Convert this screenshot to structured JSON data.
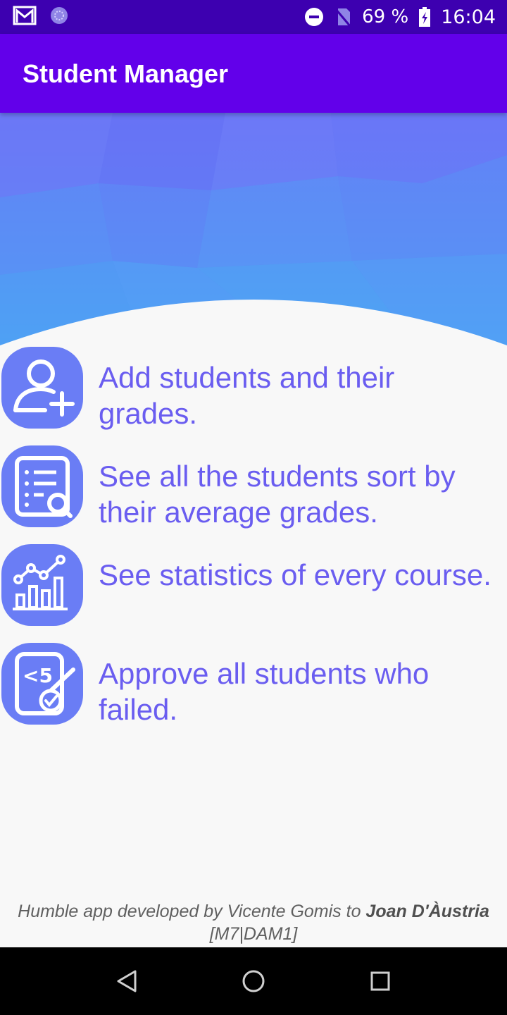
{
  "status_bar": {
    "battery": "69 %",
    "time": "16:04",
    "icons": [
      "gmail-icon",
      "sync-icon",
      "do-not-disturb-icon",
      "no-sim-icon",
      "battery-charging-icon"
    ]
  },
  "app_bar": {
    "title": "Student Manager"
  },
  "features": [
    {
      "icon": "add-user-icon",
      "text": "Add students and their grades."
    },
    {
      "icon": "list-search-icon",
      "text": "See all the students sort by their average grades."
    },
    {
      "icon": "statistics-chart-icon",
      "text": "See statistics of every course."
    },
    {
      "icon": "approve-grade-icon",
      "text": "Approve all students who failed."
    }
  ],
  "footer": {
    "prefix": "Humble app developed by Vicente Gomis to ",
    "school": "Joan D'Àustria",
    "suffix": "[M7|DAM1]"
  },
  "colors": {
    "status_bar": "#3d00b0",
    "app_bar": "#6200ea",
    "feature_text": "#6a5df0",
    "icon_bg": "#6a7df5"
  },
  "nav_bar": {
    "buttons": [
      "back-icon",
      "home-icon",
      "recents-icon"
    ]
  }
}
